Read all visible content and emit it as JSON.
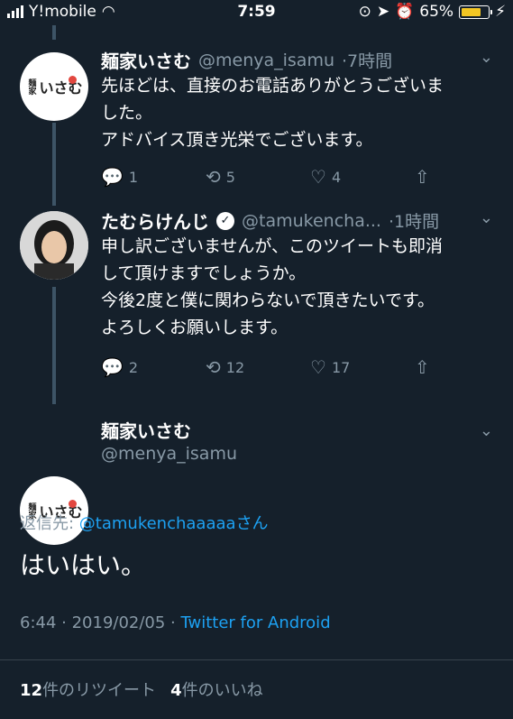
{
  "status_bar": {
    "carrier": "Y!mobile",
    "time": "7:59",
    "battery": "65%",
    "battery_level": 0.65,
    "battery_color": "#f3c623"
  },
  "tweets": [
    {
      "name": "麺家いさむ",
      "handle": "@menya_isamu",
      "age": "·7時間",
      "text": "先ほどは、直接のお電話ありがとうございま\nした。\nアドバイス頂き光栄でございます。",
      "replies": "1",
      "retweets": "5",
      "likes": "4"
    },
    {
      "name": "たむらけんじ",
      "handle": "@tamukencha...",
      "age": "·1時間",
      "text": "申し訳ございませんが、このツイートも即消\nして頂けますでしょうか。\n今後2度と僕に関わらないで頂きたいです。\nよろしくお願いします。",
      "replies": "2",
      "retweets": "12",
      "likes": "17"
    }
  ],
  "focus_tweet": {
    "name": "麺家いさむ",
    "handle": "@menya_isamu",
    "reply_prefix": "返信先: ",
    "reply_mention": "@tamukenchaaaaa",
    "reply_suffix": "さん",
    "text": "はいはい。",
    "timestamp": "6:44 · 2019/02/05 · ",
    "client": "Twitter for Android",
    "retweet_count": "12",
    "retweet_label": "件のリツイート",
    "like_count": "4",
    "like_label": "件のいいね"
  },
  "avatar_logo": {
    "main": "いさむ",
    "sub": "麺家"
  },
  "icons": {
    "reply": "reply-icon",
    "retweet": "retweet-icon",
    "like": "heart-icon",
    "share": "share-icon",
    "chevron": "chevron-down-icon",
    "verified": "verified-badge-icon"
  },
  "colors": {
    "background": "#15202b",
    "accent": "#1da1f2",
    "secondary_text": "#8899a6"
  }
}
